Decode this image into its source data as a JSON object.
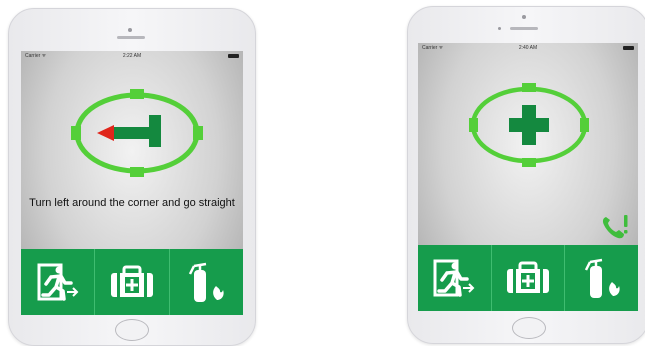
{
  "colors": {
    "accent": "#169c4c",
    "indicator_green": "#54cf39",
    "arrow_red": "#e0261b"
  },
  "left_screen": {
    "status": {
      "carrier": "Carrier ᯤ",
      "time": "2:22 AM"
    },
    "indicator_icon": "turn-left-arrow-icon",
    "instruction": "Turn left around the corner and go straight",
    "tabs": [
      {
        "icon": "emergency-exit-icon"
      },
      {
        "icon": "first-aid-kit-icon"
      },
      {
        "icon": "fire-extinguisher-icon"
      }
    ]
  },
  "right_screen": {
    "status": {
      "carrier": "Carrier ᯤ",
      "time": "2:40 AM"
    },
    "indicator_icon": "first-aid-cross-icon",
    "alert_icon": "emergency-call-icon",
    "tabs": [
      {
        "icon": "emergency-exit-icon"
      },
      {
        "icon": "first-aid-kit-icon"
      },
      {
        "icon": "fire-extinguisher-icon"
      }
    ]
  }
}
